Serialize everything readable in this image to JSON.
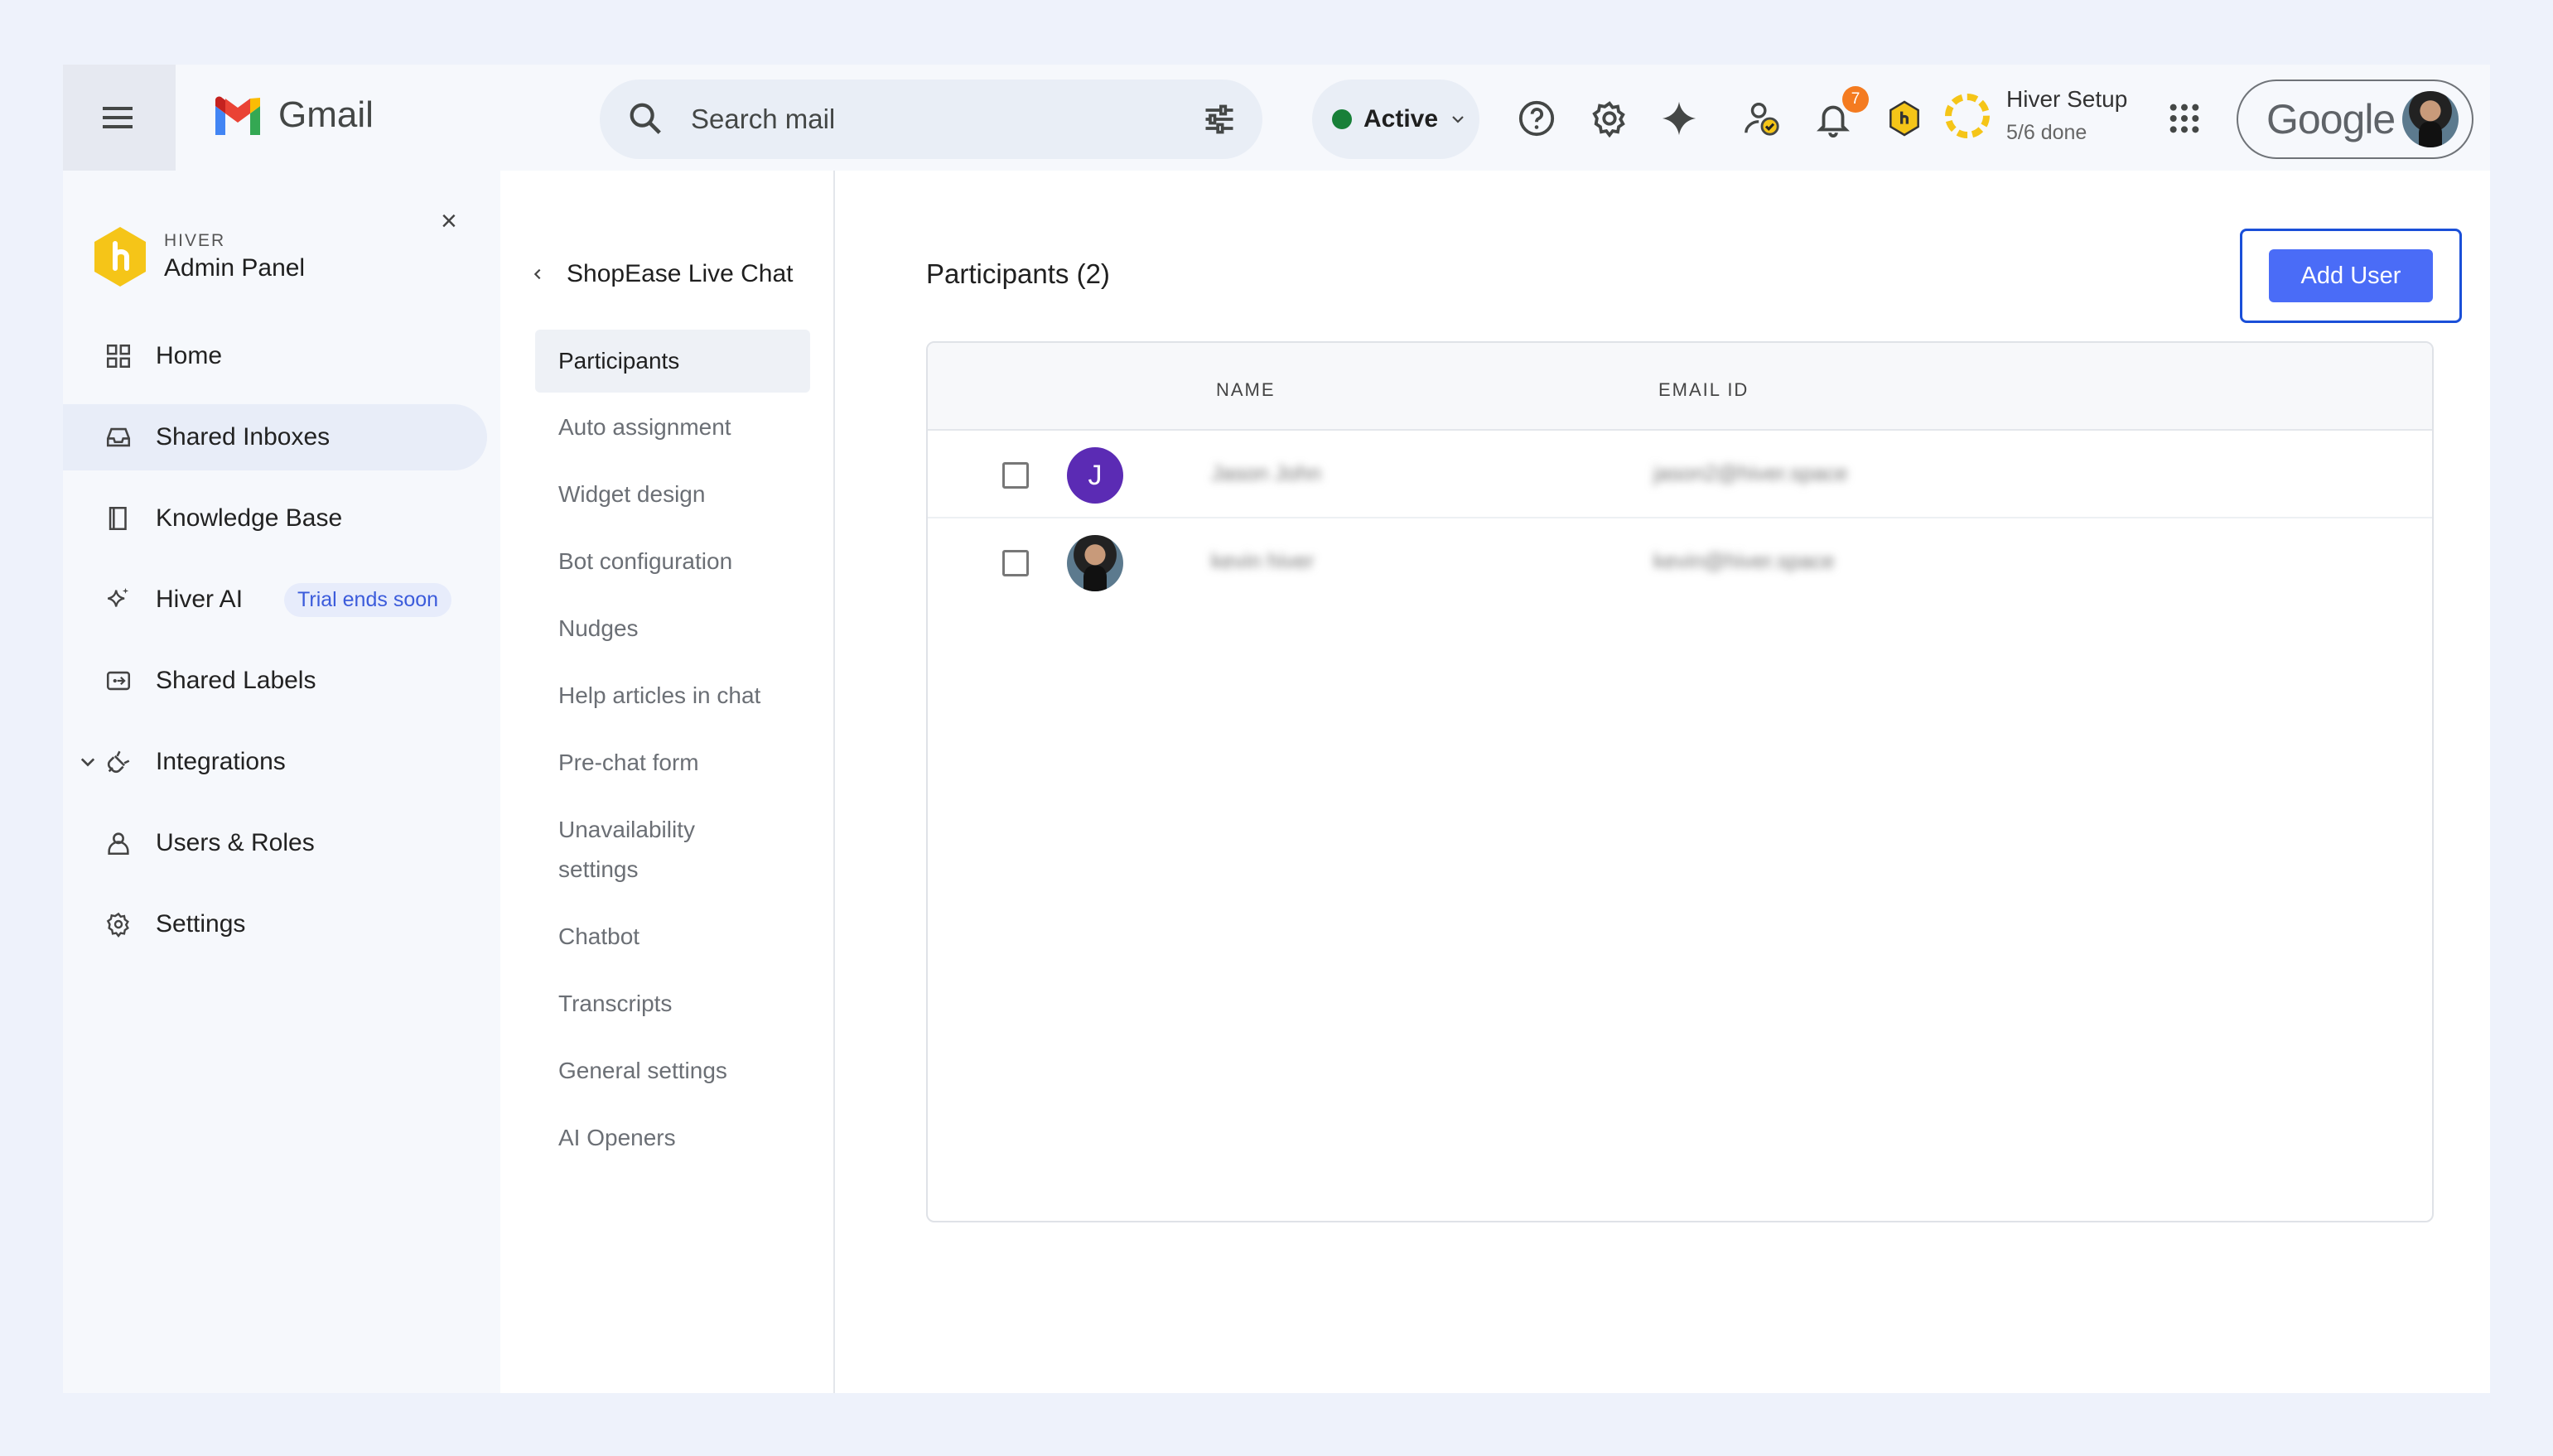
{
  "gmail": {
    "app_name": "Gmail",
    "search_placeholder": "Search mail",
    "status_label": "Active",
    "notification_count": "7",
    "setup_title": "Hiver Setup",
    "setup_progress": "5/6 done",
    "google_label": "Google"
  },
  "sidebar": {
    "brand_small": "HIVER",
    "brand_title": "Admin Panel",
    "close_symbol": "×",
    "items": [
      {
        "label": "Home",
        "icon": "grid-icon"
      },
      {
        "label": "Shared Inboxes",
        "icon": "inbox-icon",
        "selected": true
      },
      {
        "label": "Knowledge Base",
        "icon": "book-icon"
      },
      {
        "label": "Hiver AI",
        "icon": "sparkle-icon",
        "badge": "Trial ends soon"
      },
      {
        "label": "Shared Labels",
        "icon": "label-icon"
      },
      {
        "label": "Integrations",
        "icon": "plug-icon",
        "expandable": true
      },
      {
        "label": "Users & Roles",
        "icon": "user-icon"
      },
      {
        "label": "Settings",
        "icon": "gear-icon"
      }
    ]
  },
  "subnav": {
    "title": "ShopEase Live Chat",
    "items": [
      "Participants",
      "Auto assignment",
      "Widget design",
      "Bot configuration",
      "Nudges",
      "Help articles in chat",
      "Pre-chat form",
      "Unavailability settings",
      "Chatbot",
      "Transcripts",
      "General settings",
      "AI Openers"
    ],
    "selected": "Participants"
  },
  "main": {
    "title": "Participants (2)",
    "add_button": "Add User",
    "columns": [
      "NAME",
      "EMAIL ID"
    ],
    "rows": [
      {
        "initial": "J",
        "name": "Jason John",
        "email": "jason2@hiver.space",
        "avatar_color": "#5b2bb4"
      },
      {
        "initial": "",
        "name": "kevin hiver",
        "email": "kevin@hiver.space",
        "avatar_photo": true
      }
    ]
  },
  "colors": {
    "accent": "#4a6cf7",
    "accent_border": "#1a4fd8",
    "active_dot": "#188038",
    "badge": "#f47b20",
    "hiver_yellow": "#f5c518"
  }
}
